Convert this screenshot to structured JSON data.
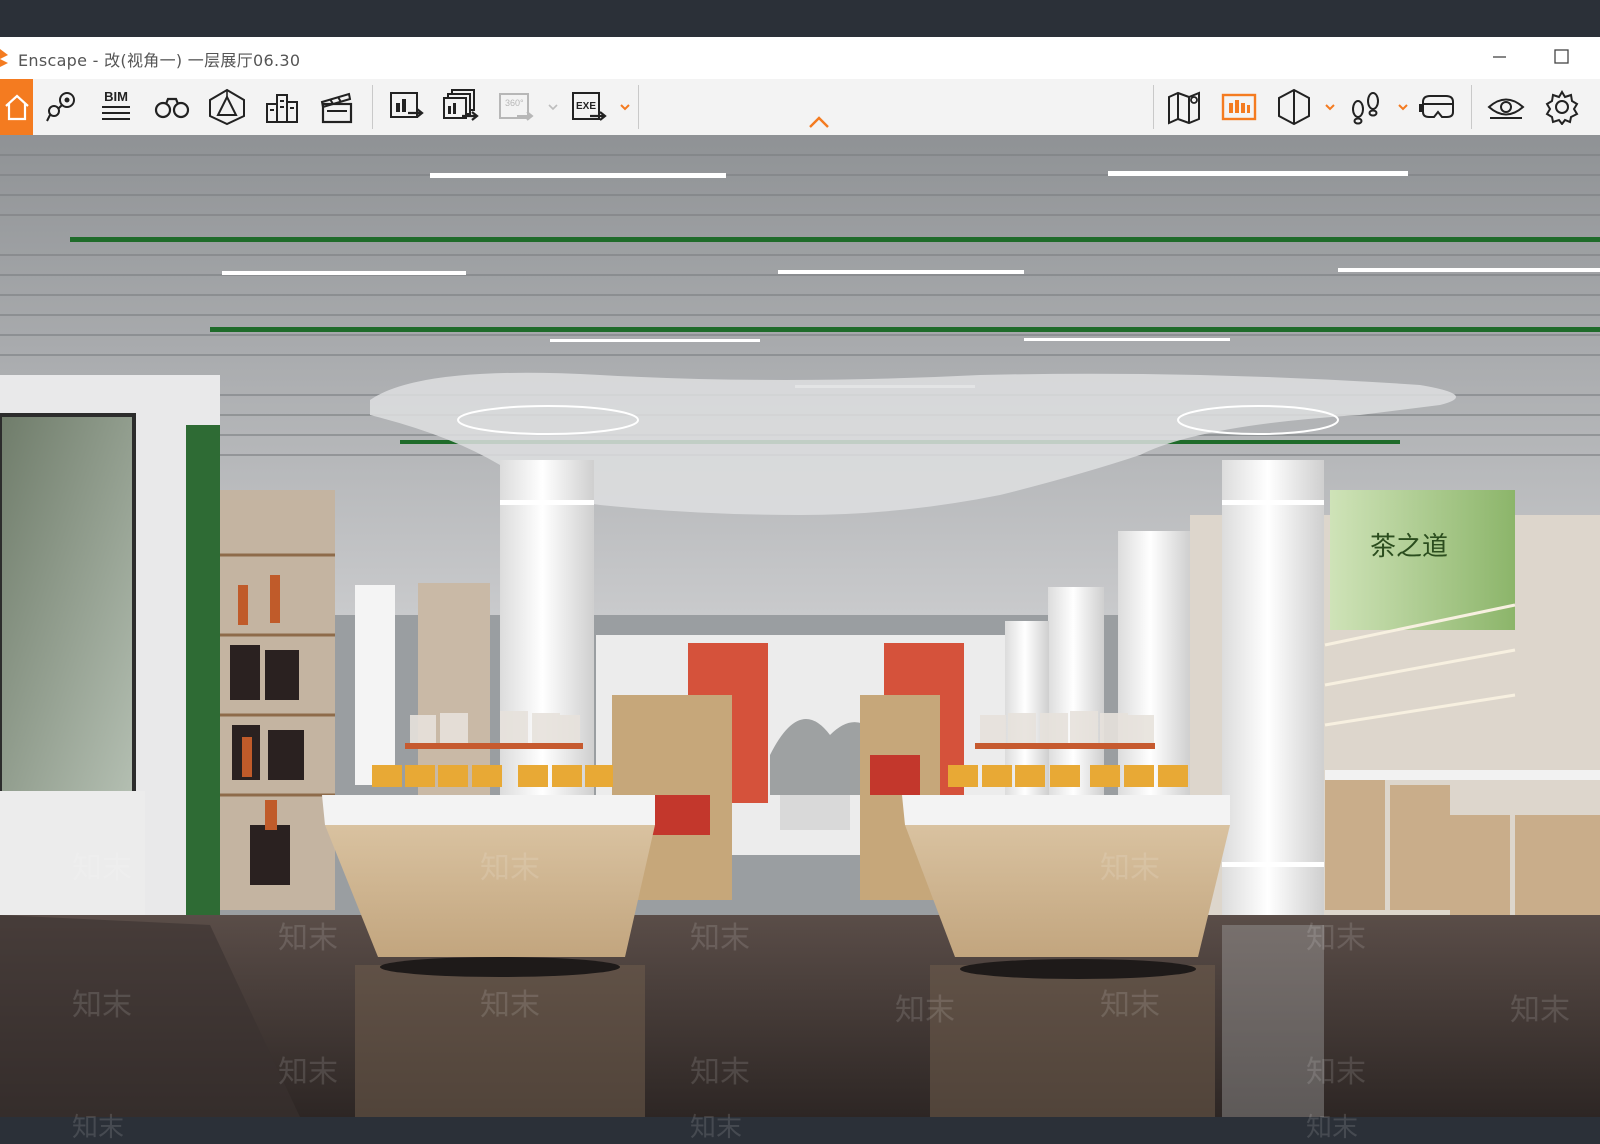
{
  "window": {
    "title": "Enscape - 改(视角一) 一层展厅06.30"
  },
  "toolbar": {
    "left_tools": [
      {
        "icon": "home-icon",
        "active": true
      },
      {
        "icon": "map-pins-icon"
      },
      {
        "icon": "bim-icon",
        "label": "BIM"
      },
      {
        "icon": "binoculars-icon"
      },
      {
        "icon": "perspective-icon"
      },
      {
        "icon": "buildings-icon"
      },
      {
        "icon": "clapperboard-icon"
      }
    ],
    "export_tools": [
      {
        "icon": "export-screenshot-icon"
      },
      {
        "icon": "batch-render-icon"
      },
      {
        "icon": "panorama-360-icon",
        "label": "360°",
        "disabled": true
      },
      {
        "icon": "export-exe-icon",
        "label": "EXE"
      }
    ],
    "right_tools": [
      {
        "icon": "map-icon"
      },
      {
        "icon": "asset-library-icon",
        "active": true
      },
      {
        "icon": "section-icon"
      },
      {
        "icon": "footsteps-icon"
      },
      {
        "icon": "vr-headset-icon"
      },
      {
        "icon": "eye-icon"
      },
      {
        "icon": "settings-gear-icon"
      }
    ],
    "accent_color": "#f47b20"
  },
  "viewport": {
    "scene_signs": {
      "tea_banner": "茶之道"
    },
    "watermark": "知末"
  }
}
